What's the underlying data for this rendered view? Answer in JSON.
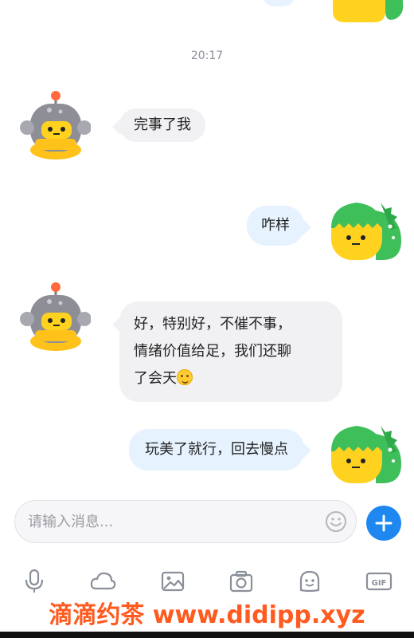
{
  "chat": {
    "timestamp": "20:17",
    "messages": [
      {
        "side": "left",
        "sender": "robot",
        "text": "完事了我"
      },
      {
        "side": "right",
        "sender": "dino",
        "text": "咋样"
      },
      {
        "side": "left",
        "sender": "robot",
        "lines": [
          "好，特别好，不催不事，",
          "情绪价值给足，我们还聊",
          "了会天"
        ],
        "emoji": "smiling-face-emoji"
      },
      {
        "side": "right",
        "sender": "dino",
        "text": "玩美了就行，回去慢点"
      }
    ]
  },
  "composer": {
    "placeholder": "请输入消息...",
    "emoji_icon": "emoji-face-icon",
    "plus_icon": "plus-icon"
  },
  "toolbar": {
    "items": [
      "microphone-icon",
      "cloud-icon",
      "image-icon",
      "camera-icon",
      "sticker-icon",
      "gif-icon"
    ],
    "gif_label": "GIF"
  },
  "watermark": "滴滴约茶 www.didipp.xyz",
  "colors": {
    "accent": "#1e88f0",
    "left_bubble": "#f1f1f4",
    "right_bubble": "#e6f3ff",
    "watermark": "#ff5a1f",
    "dino_green": "#3fbf5a",
    "face_yellow": "#ffd21f"
  }
}
